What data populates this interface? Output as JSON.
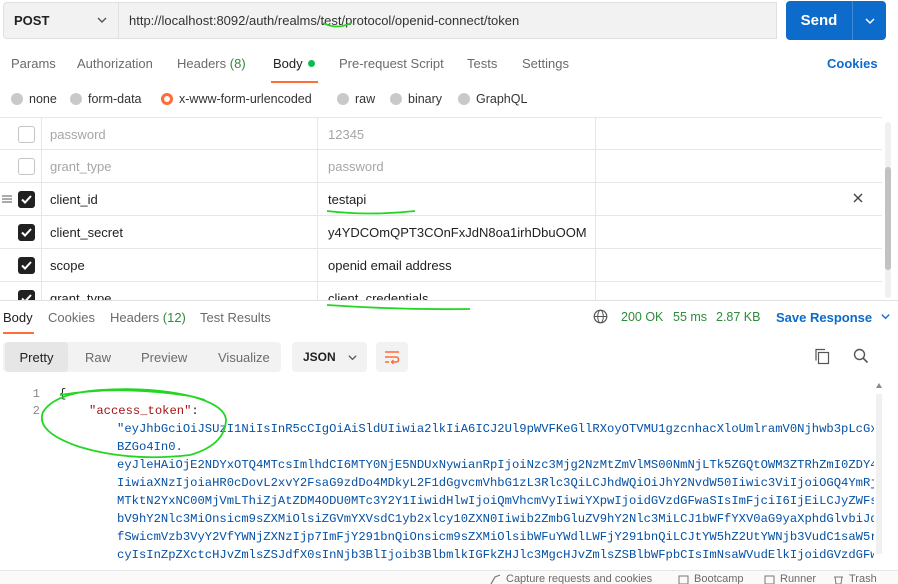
{
  "request": {
    "method": "POST",
    "url": "http://localhost:8092/auth/realms/test/protocol/openid-connect/token",
    "send_label": "Send"
  },
  "request_tabs": [
    {
      "label": "Params"
    },
    {
      "label": "Authorization"
    },
    {
      "label": "Headers",
      "count": "(8)"
    },
    {
      "label": "Body"
    },
    {
      "label": "Pre-request Script"
    },
    {
      "label": "Tests"
    },
    {
      "label": "Settings"
    }
  ],
  "cookies_label": "Cookies",
  "body_types": [
    {
      "label": "none"
    },
    {
      "label": "form-data"
    },
    {
      "label": "x-www-form-urlencoded",
      "selected": true
    },
    {
      "label": "raw"
    },
    {
      "label": "binary"
    },
    {
      "label": "GraphQL"
    }
  ],
  "params": [
    {
      "key": "password",
      "value": "12345",
      "enabled": false
    },
    {
      "key": "grant_type",
      "value": "password",
      "enabled": false
    },
    {
      "key": "client_id",
      "value": "testapi",
      "enabled": true
    },
    {
      "key": "client_secret",
      "value": "y4YDCOmQPT3COnFxJdN8oa1irhDbuOOM",
      "enabled": true
    },
    {
      "key": "scope",
      "value": "openid email address",
      "enabled": true
    },
    {
      "key": "grant_type",
      "value": "client_credentials",
      "enabled": true
    }
  ],
  "response": {
    "tabs": [
      {
        "label": "Body"
      },
      {
        "label": "Cookies"
      },
      {
        "label": "Headers",
        "count": "(12)"
      },
      {
        "label": "Test Results"
      }
    ],
    "status": "200 OK",
    "time": "55 ms",
    "size": "2.87 KB",
    "save_label": "Save Response",
    "view_modes": [
      "Pretty",
      "Raw",
      "Preview",
      "Visualize"
    ],
    "format": "JSON",
    "line_numbers": [
      "1",
      "2"
    ],
    "open_brace": "{",
    "json_key": "\"access_token\"",
    "colon": ":",
    "token_lines": [
      "\"eyJhbGciOiJSUzI1NiIsInR5cCIgOiAiSldUIiwia2lkIiA6ICJ2Ul9pWVFKeGllRXoyOTVMU1gzcnhacXloUmlramV0Njhwb3pLcGx",
      "BZGo4In0.",
      "eyJleHAiOjE2NDYxOTQ4MTcsImlhdCI6MTY0NjE5NDUxNywianRpIjoiNzc3Mjg2NzMtZmVlMS00NmNjLTk5ZGQtOWM3ZTRhZmI0ZDY4",
      "IiwiaXNzIjoiaHR0cDovL2xvY2FsaG9zdDo4MDkyL2F1dGgvcmVhbG1zL3Rlc3QiLCJhdWQiOiJhY2NvdW50Iiwic3ViIjoiOGQ4YmRj",
      "MTktN2YxNC00MjVmLThiZjAtZDM4ODU0MTc3Y2Y1IiwidHlwIjoiQmVhcmVyIiwiYXpwIjoidGVzdGFwaSIsImFjciI6IjEiLCJyZWFs",
      "bV9hY2Nlc3MiOnsicm9sZXMiOlsiZGVmYXVsdC1yb2xlcy10ZXN0Iiwib2ZmbGluZV9hY2Nlc3MiLCJ1bWFfYXV0aG9yaXphdGlvbiJd",
      "fSwicmVzb3VyY2VfYWNjZXNzIjp7ImFjY291bnQiOnsicm9sZXMiOlsibWFuYWdlLWFjY291bnQiLCJtYW5hZ2UtYWNjb3VudC1saW5r",
      "cyIsInZpZXctcHJvZmlsZSJdfX0sInNjb3BlIjoib3BlbmlkIGFkZHJlc3MgcHJvZmlsZSBlbWFpbCIsImNsaWVudElkIjoidGVzdGFw"
    ]
  },
  "footer": {
    "capture": "Capture requests and cookies",
    "bootcamp": "Bootcamp",
    "runner": "Runner",
    "trash": "Trash"
  },
  "colors": {
    "accent": "#ff6c37",
    "primary": "#0c6bcb",
    "success": "#2c8c3a",
    "annotation": "#22d622"
  }
}
